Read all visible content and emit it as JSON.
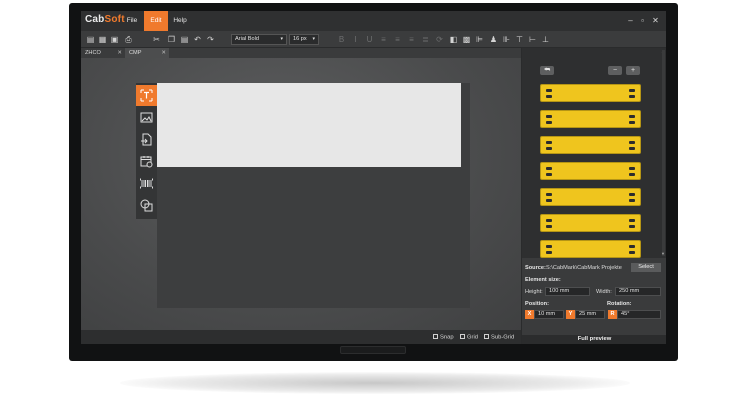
{
  "app": {
    "logo_main": "Cab",
    "logo_accent": "Soft",
    "menu": [
      "File",
      "Edit",
      "Help"
    ],
    "active_menu": "Edit",
    "window_controls": [
      "minimize-icon",
      "restore-icon",
      "close-icon"
    ]
  },
  "toolbar": {
    "icons": [
      "new-file-icon",
      "open-folder-icon",
      "save-icon",
      "print-icon",
      "cut-icon",
      "copy-icon",
      "paste-icon",
      "undo-icon",
      "redo-icon"
    ],
    "font_family": "Arial Bold",
    "font_size": "16 px",
    "format_icons": [
      "bold-icon",
      "italic-icon",
      "underline-icon",
      "align-left-icon",
      "align-center-icon",
      "align-right-icon",
      "justify-icon",
      "rotate-icon",
      "layer-icon",
      "bring-front-icon",
      "align-left-edges-icon",
      "align-centers-icon",
      "align-right-edges-icon",
      "align-top-icon",
      "align-middle-icon",
      "align-bottom-icon"
    ]
  },
  "tabs": [
    {
      "label": "ZHCO",
      "active": false
    },
    {
      "label": "CMP",
      "active": true
    }
  ],
  "tools": [
    "text-tool-icon",
    "image-tool-icon",
    "import-tool-icon",
    "date-tool-icon",
    "barcode-tool-icon",
    "shape-tool-icon"
  ],
  "status": {
    "snap": "Snap",
    "grid": "Grid",
    "subgrid": "Sub-Grid"
  },
  "preview": {
    "back_icon": "back-arrow-icon",
    "zoom_out": "−",
    "zoom_in": "+",
    "tag_count": 7,
    "tag_color": "#efc51e"
  },
  "properties": {
    "source_label": "Source:",
    "source_path": "S:\\CabMark\\CabMark Projekte",
    "select_button": "Select",
    "element_size_label": "Element size:",
    "height_label": "Height:",
    "height_value": "100 mm",
    "width_label": "Width:",
    "width_value": "250 mm",
    "position_label": "Position:",
    "rotation_label": "Rotation:",
    "x_axis": "X",
    "x_value": "10 mm",
    "y_axis": "Y",
    "y_value": "25 mm",
    "r_axis": "R",
    "r_value": "45°",
    "full_preview": "Full preview"
  },
  "colors": {
    "accent": "#f07a2d",
    "background": "#444546"
  }
}
